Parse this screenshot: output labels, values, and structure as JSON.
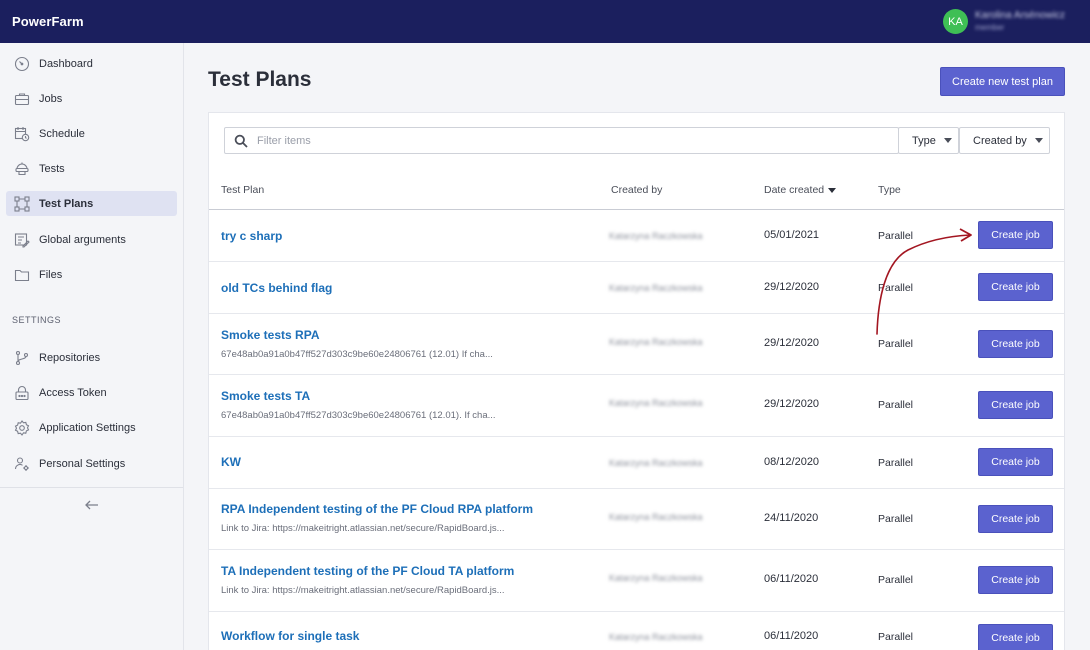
{
  "app": {
    "name": "PowerFarm"
  },
  "user": {
    "initials": "KA",
    "name": "Karolina Arsénowicz",
    "role": "member",
    "avatar_color": "#3fbf55"
  },
  "sidebar": {
    "items": [
      {
        "label": "Dashboard",
        "icon": "speedometer-icon"
      },
      {
        "label": "Jobs",
        "icon": "briefcase-icon"
      },
      {
        "label": "Schedule",
        "icon": "calendar-icon"
      },
      {
        "label": "Tests",
        "icon": "robot-icon"
      },
      {
        "label": "Test Plans",
        "icon": "flow-icon",
        "active": true
      },
      {
        "label": "Global arguments",
        "icon": "edit-list-icon"
      },
      {
        "label": "Files",
        "icon": "folder-icon"
      }
    ],
    "settings_label": "SETTINGS",
    "settings_items": [
      {
        "label": "Repositories",
        "icon": "branch-icon"
      },
      {
        "label": "Access Token",
        "icon": "lock-icon"
      },
      {
        "label": "Application Settings",
        "icon": "gear-icon"
      },
      {
        "label": "Personal Settings",
        "icon": "person-gear-icon"
      }
    ],
    "collapse_icon": "arrow-left-icon"
  },
  "page": {
    "title": "Test Plans",
    "create_button": "Create new test plan"
  },
  "filters": {
    "placeholder": "Filter items",
    "type_label": "Type",
    "created_by_label": "Created by"
  },
  "table": {
    "columns": {
      "plan": "Test Plan",
      "created_by": "Created by",
      "date_created": "Date created",
      "type": "Type"
    },
    "sorted_by": "date_created",
    "sort_direction": "desc",
    "action_label": "Create job",
    "rows": [
      {
        "name": "try c sharp",
        "description": "",
        "created_by": "Katarzyna Raczkowska",
        "date": "05/01/2021",
        "type": "Parallel"
      },
      {
        "name": "old TCs behind flag",
        "description": "",
        "created_by": "Katarzyna Raczkowska",
        "date": "29/12/2020",
        "type": "Parallel"
      },
      {
        "name": "Smoke tests RPA",
        "description": "67e48ab0a91a0b47ff527d303c9be60e24806761 (12.01) If cha...",
        "created_by": "Katarzyna Raczkowska",
        "date": "29/12/2020",
        "type": "Parallel"
      },
      {
        "name": "Smoke tests TA",
        "description": "67e48ab0a91a0b47ff527d303c9be60e24806761 (12.01). If cha...",
        "created_by": "Katarzyna Raczkowska",
        "date": "29/12/2020",
        "type": "Parallel"
      },
      {
        "name": "KW",
        "description": "",
        "created_by": "Katarzyna Raczkowska",
        "date": "08/12/2020",
        "type": "Parallel"
      },
      {
        "name": "RPA Independent testing of the PF Cloud RPA platform",
        "description": "Link to Jira: https://makeitright.atlassian.net/secure/RapidBoard.js...",
        "created_by": "Katarzyna Raczkowska",
        "date": "24/11/2020",
        "type": "Parallel"
      },
      {
        "name": "TA Independent testing of the PF Cloud TA platform",
        "description": "Link to Jira: https://makeitright.atlassian.net/secure/RapidBoard.js...",
        "created_by": "Katarzyna Raczkowska",
        "date": "06/11/2020",
        "type": "Parallel"
      },
      {
        "name": "Workflow for single task",
        "description": "",
        "created_by": "Katarzyna Raczkowska",
        "date": "06/11/2020",
        "type": "Parallel"
      }
    ]
  },
  "annotation": {
    "color": "#a31621",
    "icon": "curved-arrow-annotation"
  }
}
